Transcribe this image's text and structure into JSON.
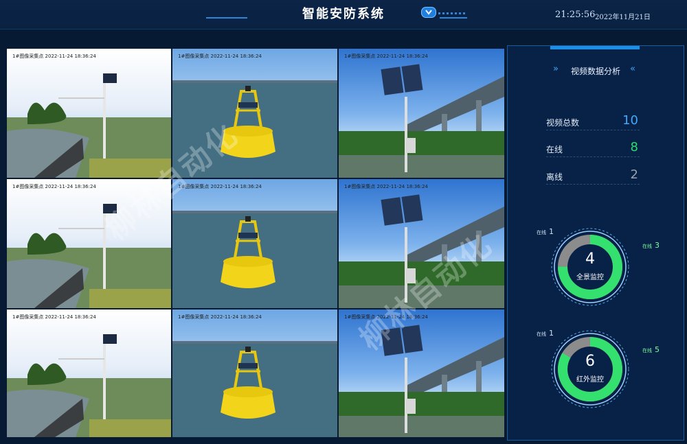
{
  "header": {
    "title": "智能安防系统",
    "time": "21:25:56",
    "date": "2022年11月21日"
  },
  "cameras": [
    {
      "timestamp": "1#图像采集点  2022-11-24  18:36:24",
      "scene": "river-pole"
    },
    {
      "timestamp": "1#图像采集点  2022-11-24  18:36:24",
      "scene": "buoy"
    },
    {
      "timestamp": "1#图像采集点  2022-11-24  18:36:24",
      "scene": "bridge-pole"
    },
    {
      "timestamp": "1#图像采集点  2022-11-24  18:36:24",
      "scene": "river-pole"
    },
    {
      "timestamp": "1#图像采集点  2022-11-24  18:36:24",
      "scene": "buoy"
    },
    {
      "timestamp": "1#图像采集点  2022-11-24  18:36:24",
      "scene": "bridge-pole"
    },
    {
      "timestamp": "1#图像采集点  2022-11-24  18:36:24",
      "scene": "river-pole"
    },
    {
      "timestamp": "1#图像采集点  2022-11-24  18:36:24",
      "scene": "buoy"
    },
    {
      "timestamp": "1#图像采集点  2022-11-24  18:36:24",
      "scene": "bridge-pole"
    }
  ],
  "watermark": "柳林自动化",
  "panel": {
    "title": "视频数据分析",
    "stats": {
      "total_label": "视频总数",
      "total": "10",
      "online_label": "在线",
      "online": "8",
      "offline_label": "离线",
      "offline": "2"
    },
    "panorama": {
      "count": "4",
      "label": "全景监控",
      "offline_label": "在线",
      "offline": "1",
      "online_label": "在线",
      "online": "3",
      "online_fraction": 0.75
    },
    "infrared": {
      "count": "6",
      "label": "红外监控",
      "offline_label": "在线",
      "offline": "1",
      "online_label": "在线",
      "online": "5",
      "online_fraction": 0.833
    }
  },
  "colors": {
    "accent": "#1a8fe8",
    "total": "#3fa9ff",
    "online": "#27e06a",
    "offline": "#9aa3ad",
    "donut_green": "#34e06e",
    "donut_gray": "#8c8c8c"
  }
}
